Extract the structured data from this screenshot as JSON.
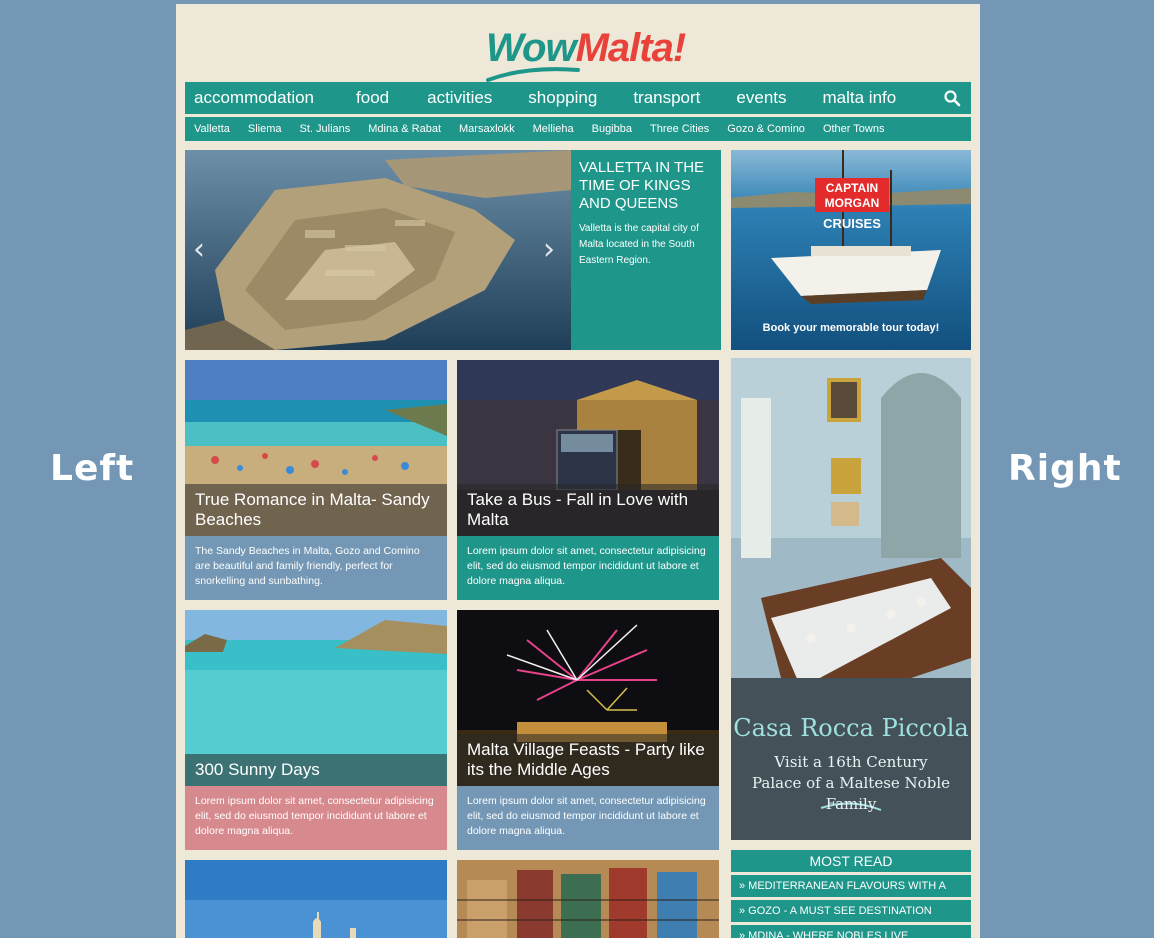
{
  "side_labels": {
    "left": "Left",
    "right": "Right"
  },
  "logo": {
    "wow": "Wow",
    "malta": "Malta!"
  },
  "main_nav": [
    "accommodation",
    "food",
    "activities",
    "shopping",
    "transport",
    "events",
    "malta info"
  ],
  "sub_nav": [
    "Valletta",
    "Sliema",
    "St. Julians",
    "Mdina & Rabat",
    "Marsaxlokk",
    "Mellieha",
    "Bugibba",
    "Three Cities",
    "Gozo & Comino",
    "Other Towns"
  ],
  "slider": {
    "title": "VALLETTA IN THE TIME OF KINGS AND QUEENS",
    "text": "Valletta is the capital city of Malta located in the South Eastern Region.",
    "prev": "‹",
    "next": "›"
  },
  "ad_captain": {
    "logo_line1": "CAPTAIN",
    "logo_line2": "MORGAN",
    "sub": "CRUISES",
    "cta": "Book your memorable tour today!"
  },
  "cards": [
    {
      "title": "True Romance in Malta- Sandy Beaches",
      "text": "The Sandy Beaches in Malta, Gozo and Comino are beautiful and family friendly, perfect for snorkelling and sunbathing."
    },
    {
      "title": "Take a Bus - Fall in Love with Malta",
      "text": "Lorem ipsum dolor sit amet, consectetur adipisicing elit, sed do eiusmod tempor incididunt ut labore et dolore magna aliqua."
    },
    {
      "title": "300 Sunny Days",
      "text": "Lorem ipsum dolor sit amet, consectetur adipisicing elit, sed do eiusmod tempor incididunt ut labore et dolore magna aliqua."
    },
    {
      "title": "Malta Village Feasts - Party like its the Middle Ages",
      "text": "Lorem ipsum dolor sit amet, consectetur adipisicing elit, sed do eiusmod tempor incididunt ut labore et dolore magna aliqua."
    }
  ],
  "ad_casa": {
    "title": "Casa Rocca Piccola",
    "sub": "Visit a 16th Century Palace of a Maltese Noble Family"
  },
  "most_read": {
    "header": "MOST READ",
    "items": [
      "» MEDITERRANEAN FLAVOURS WITH A",
      "» GOZO - A MUST SEE DESTINATION",
      "» MDINA - WHERE NOBLES LIVE"
    ]
  },
  "colors": {
    "teal": "#1f968a",
    "blue": "#7397b4",
    "cream": "#ede8d8",
    "red": "#e8423a",
    "pink": "#d68a8d"
  }
}
